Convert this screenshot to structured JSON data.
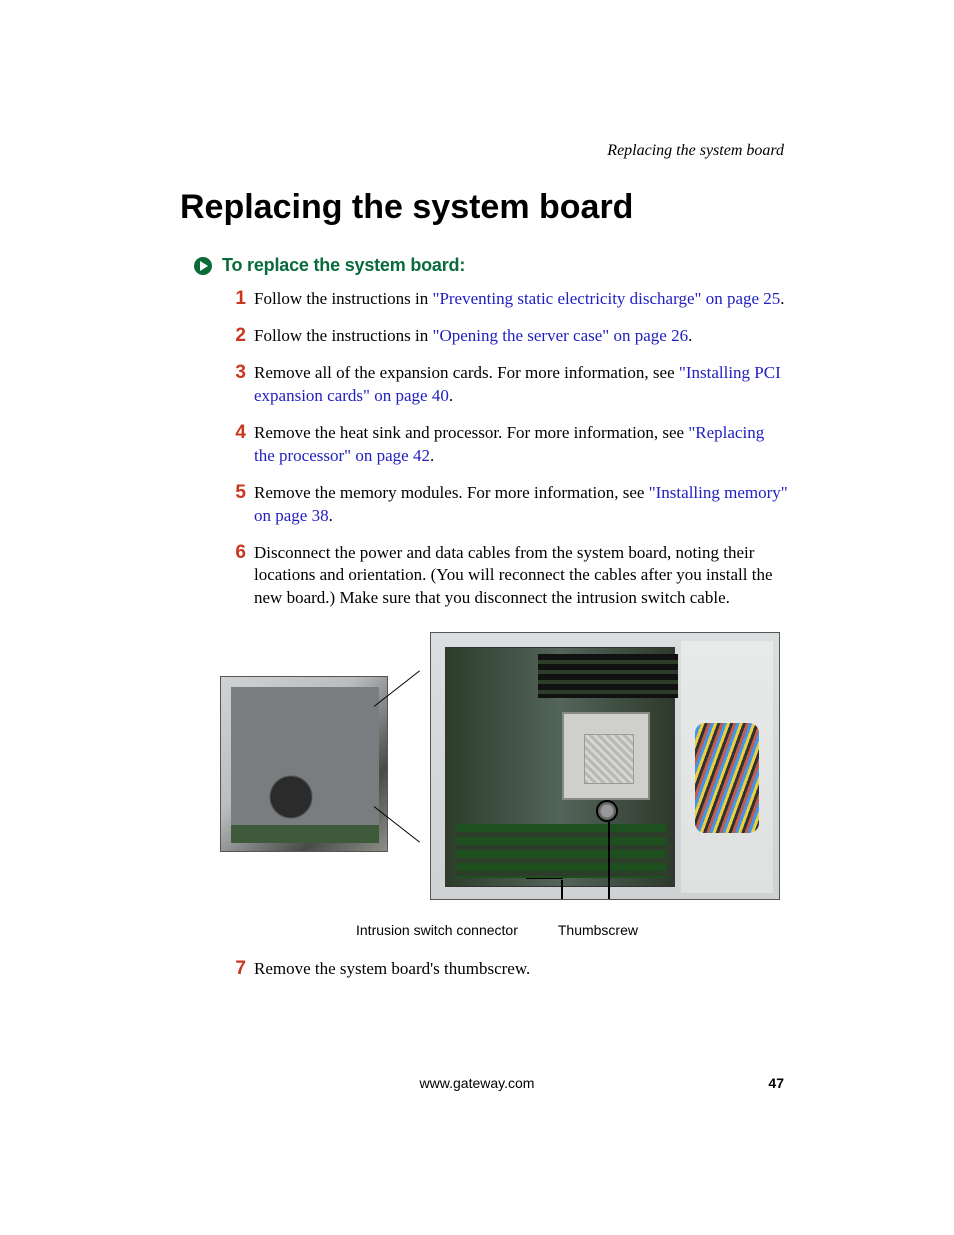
{
  "running_head": "Replacing the system board",
  "title": "Replacing the system board",
  "procedure_title": "To replace the system board:",
  "steps": [
    {
      "pre": "Follow the instructions in ",
      "link": "\"Preventing static electricity discharge\" on page 25",
      "post": "."
    },
    {
      "pre": "Follow the instructions in ",
      "link": "\"Opening the server case\" on page 26",
      "post": "."
    },
    {
      "pre": "Remove all of the expansion cards. For more information, see ",
      "link": "\"Installing PCI expansion cards\" on page 40",
      "post": "."
    },
    {
      "pre": "Remove the heat sink and processor. For more information, see ",
      "link": "\"Replacing the processor\" on page 42",
      "post": "."
    },
    {
      "pre": "Remove the memory modules. For more information, see ",
      "link": "\"Installing memory\" on page 38",
      "post": "."
    },
    {
      "pre": "Disconnect the power and data cables from the system board, noting their locations and orientation. (You will reconnect the cables after you install the new board.) Make sure that you disconnect the intrusion switch cable.",
      "link": "",
      "post": ""
    },
    {
      "pre": "Remove the system board's thumbscrew.",
      "link": "",
      "post": ""
    }
  ],
  "figure": {
    "caption_left": "Intrusion switch connector",
    "caption_right": "Thumbscrew"
  },
  "footer": {
    "url": "www.gateway.com",
    "page": "47"
  }
}
